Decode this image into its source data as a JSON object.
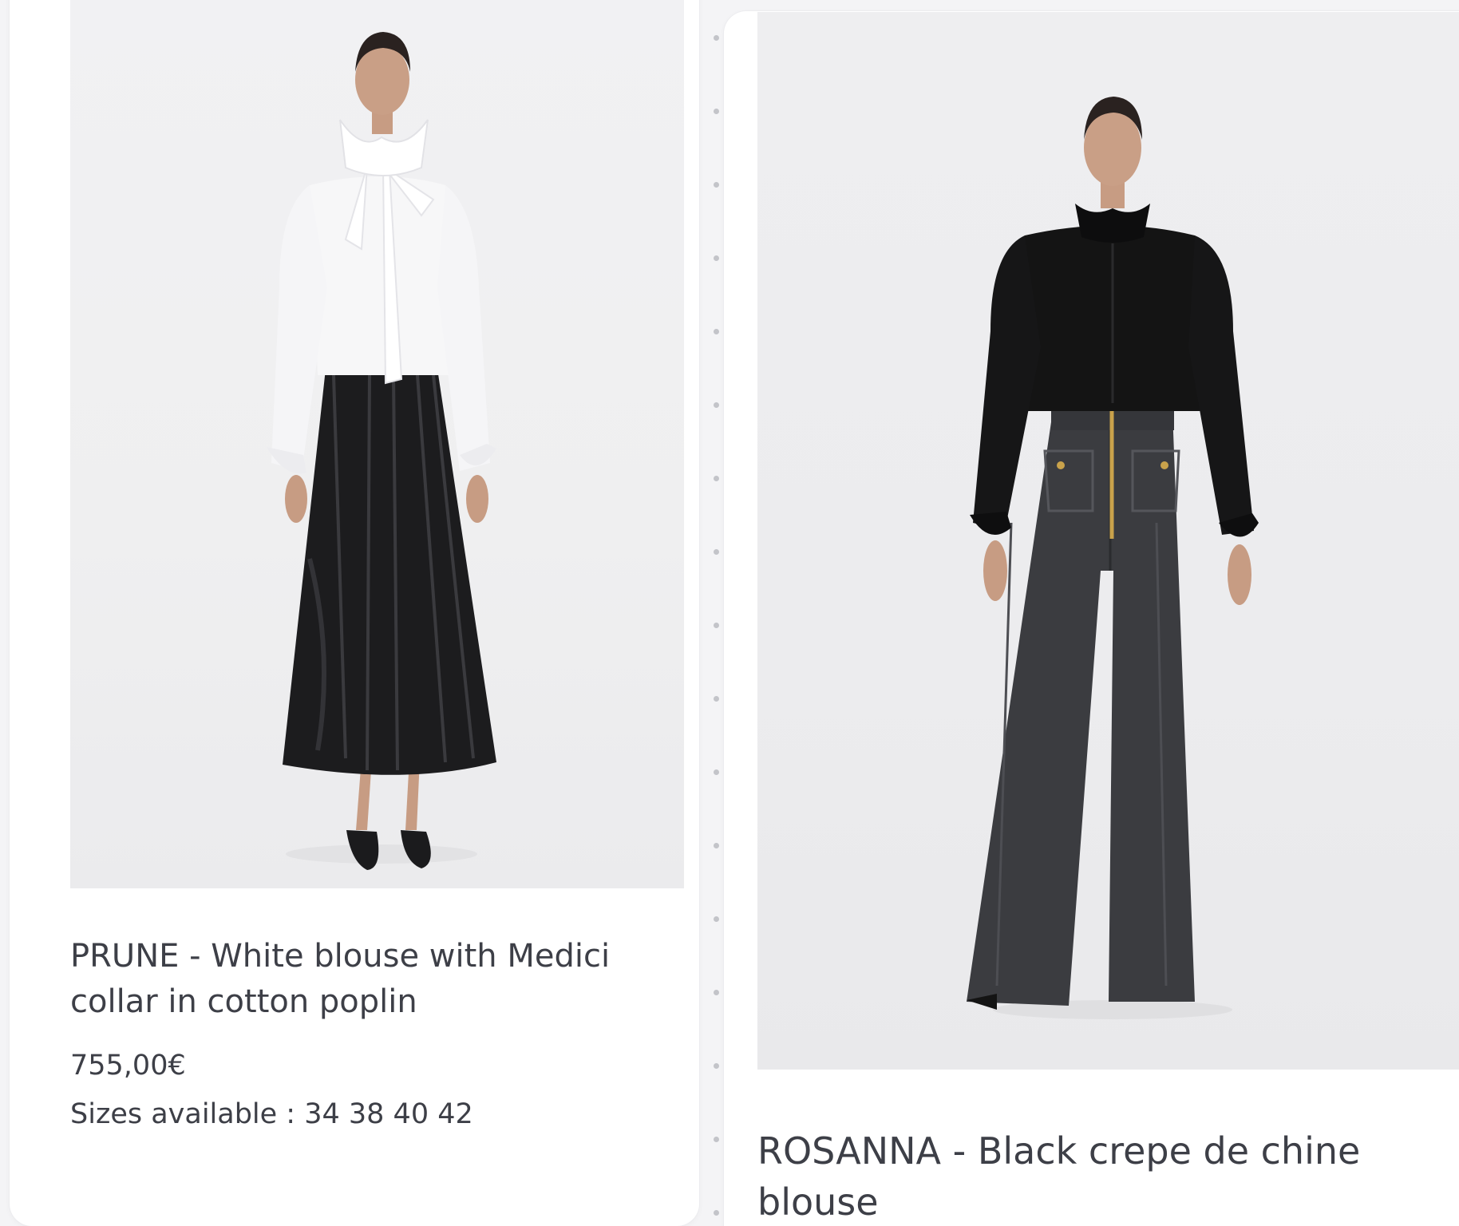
{
  "products": [
    {
      "name": "PRUNE - White blouse with Medici collar in cotton poplin",
      "price": "755,00€",
      "sizes": "Sizes available : 34 38 40 42",
      "image_alt": "Model wearing a white blouse with Medici collar and a black pleated skirt"
    },
    {
      "name": "ROSANNA - Black crepe de chine blouse",
      "image_alt": "Model wearing a black crepe de chine blouse and grey wide-leg trousers"
    }
  ],
  "colors": {
    "card_background": "#ffffff",
    "page_background": "#f4f4f6",
    "text": "#3d3f47",
    "photo_background": "#efeff1"
  }
}
